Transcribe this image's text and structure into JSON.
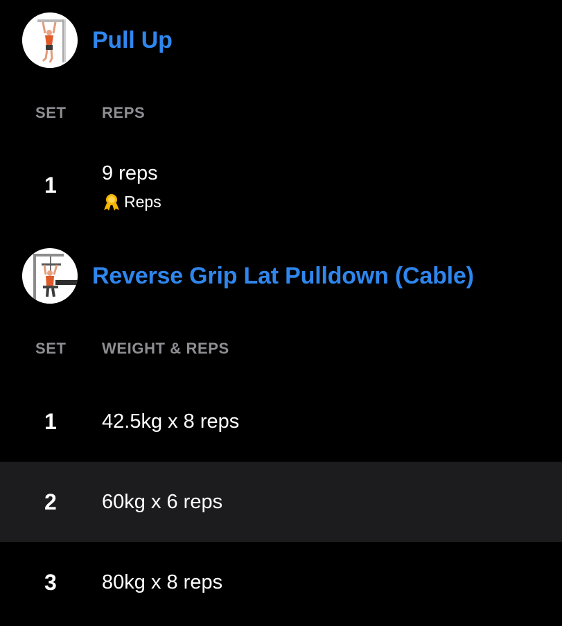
{
  "exercises": [
    {
      "title": "Pull Up",
      "thumbnail": "pull-up-illustration",
      "columns": {
        "set": "SET",
        "value": "REPS"
      },
      "sets": [
        {
          "set": "1",
          "value": "9 reps",
          "badge": {
            "icon": "medal-icon",
            "label": "Reps"
          }
        }
      ]
    },
    {
      "title": "Reverse Grip Lat Pulldown (Cable)",
      "thumbnail": "lat-pulldown-illustration",
      "columns": {
        "set": "SET",
        "value": "WEIGHT & REPS"
      },
      "sets": [
        {
          "set": "1",
          "value": "42.5kg x 8 reps"
        },
        {
          "set": "2",
          "value": "60kg x 6 reps"
        },
        {
          "set": "3",
          "value": "80kg x 8 reps"
        }
      ]
    }
  ],
  "colors": {
    "background": "#000000",
    "title": "#2f86ec",
    "column_header": "#8e8e93",
    "row_alt": "#1c1c1e",
    "medal": "#f5b400"
  }
}
